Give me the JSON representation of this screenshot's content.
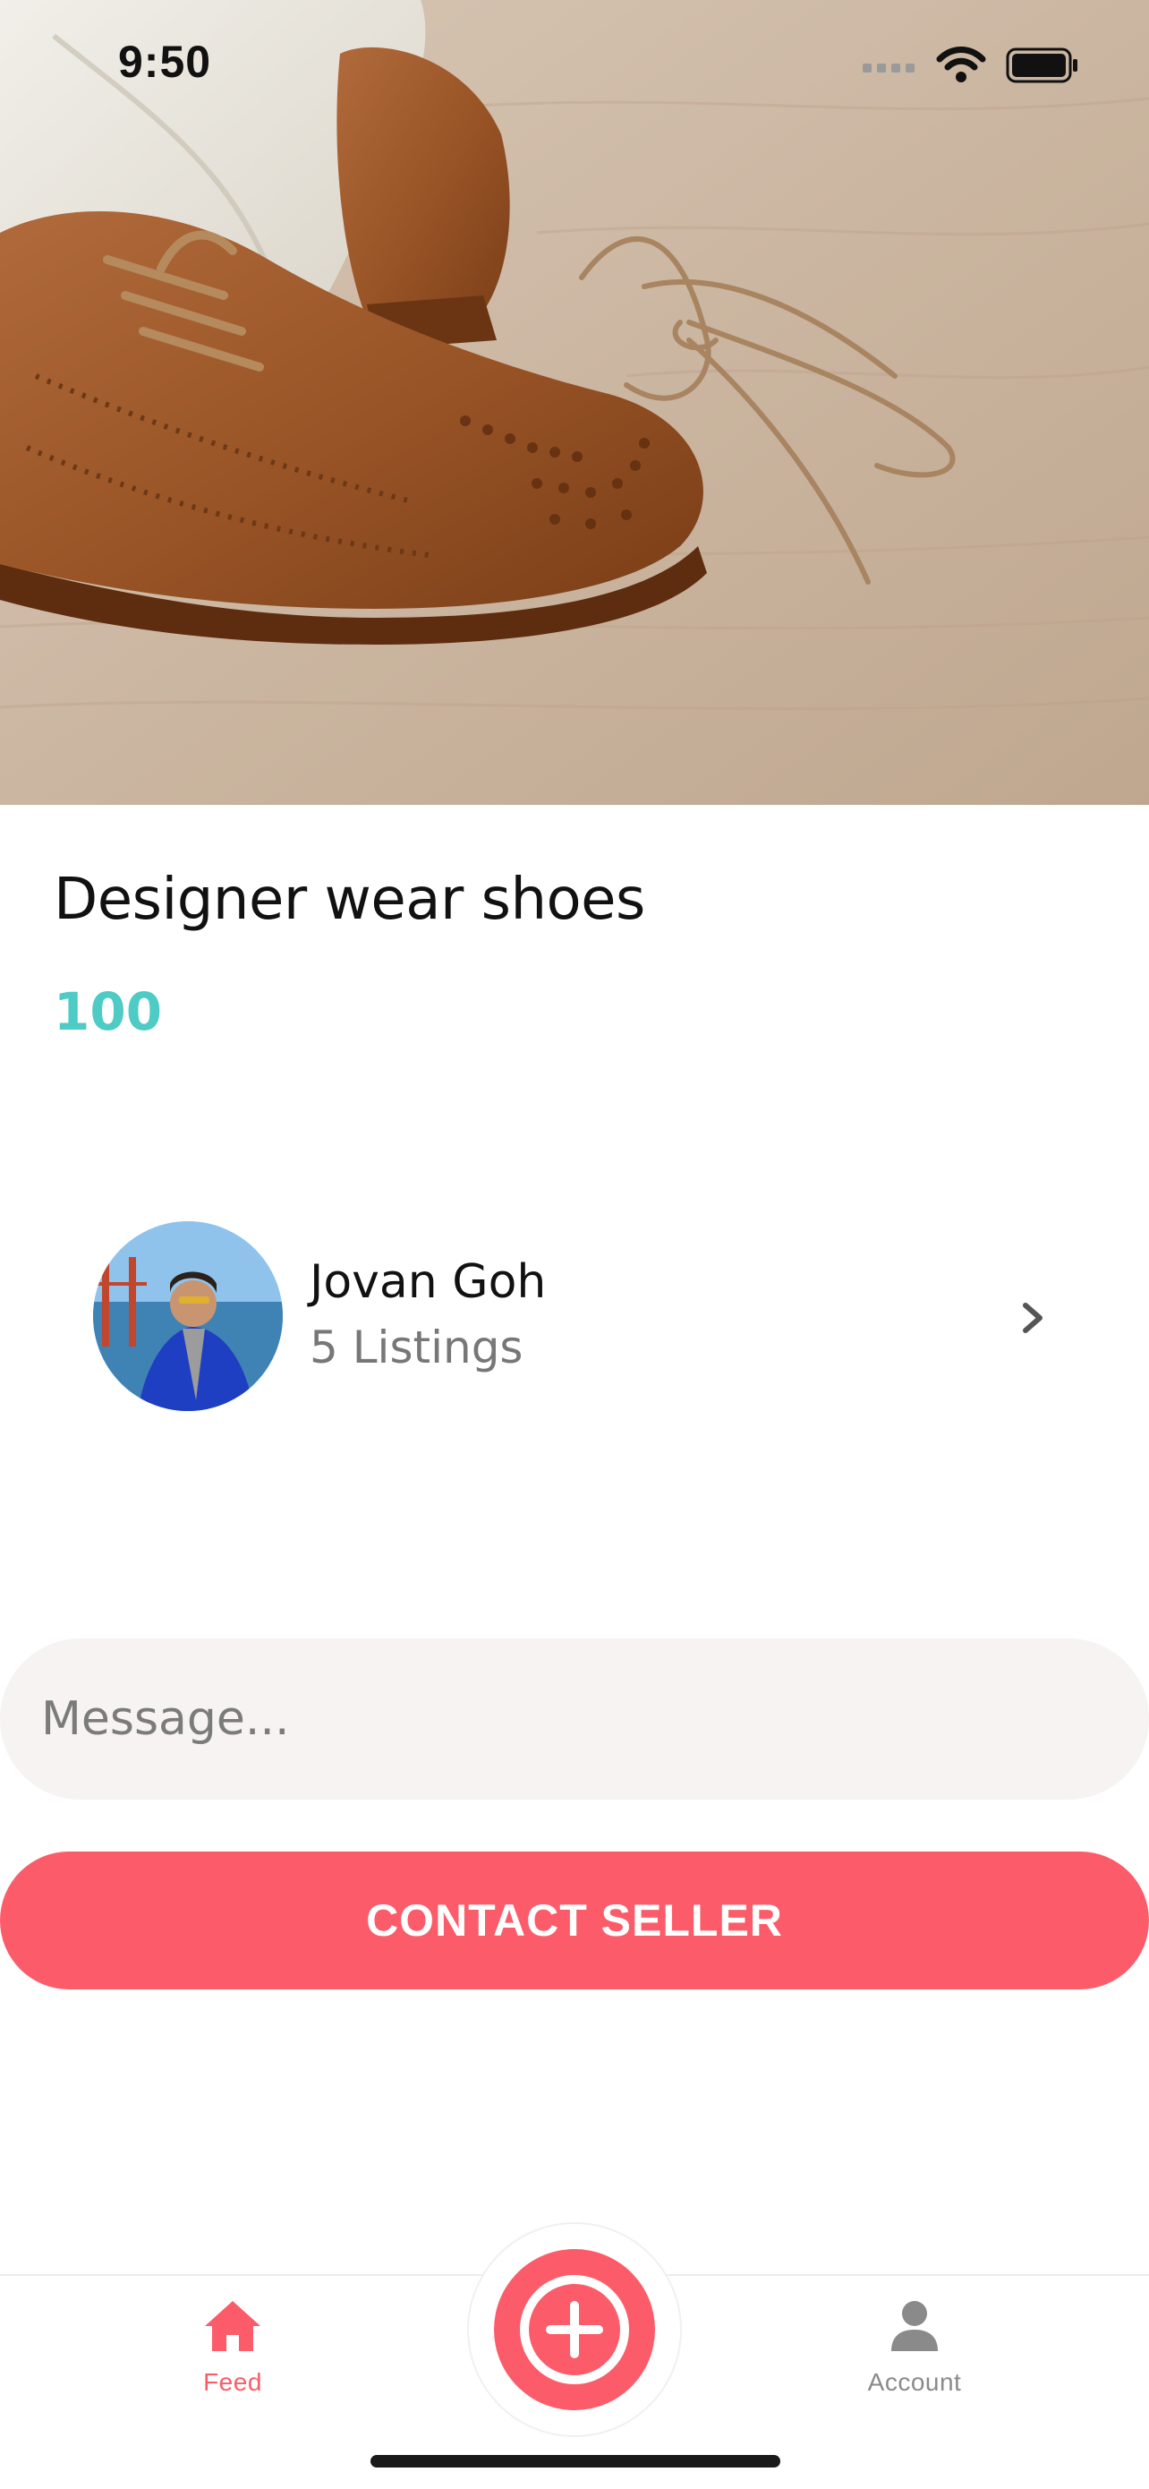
{
  "status_bar": {
    "time": "9:50"
  },
  "product": {
    "title": "Designer wear shoes",
    "price": "100"
  },
  "seller": {
    "name": "Jovan Goh",
    "listings": "5 Listings"
  },
  "message": {
    "placeholder": "Message..."
  },
  "actions": {
    "contact_label": "CONTACT SELLER"
  },
  "tab_bar": {
    "feed_label": "Feed",
    "account_label": "Account"
  },
  "colors": {
    "accent": "#fc5c69",
    "price": "#4ecbc4",
    "message_bg": "#f6f3f2"
  },
  "icons": {
    "status": [
      "cellular-signal-icon",
      "wifi-icon",
      "battery-icon"
    ],
    "seller_row": "chevron-right-icon",
    "tabs": [
      "home-icon",
      "plus-icon",
      "person-icon"
    ]
  }
}
